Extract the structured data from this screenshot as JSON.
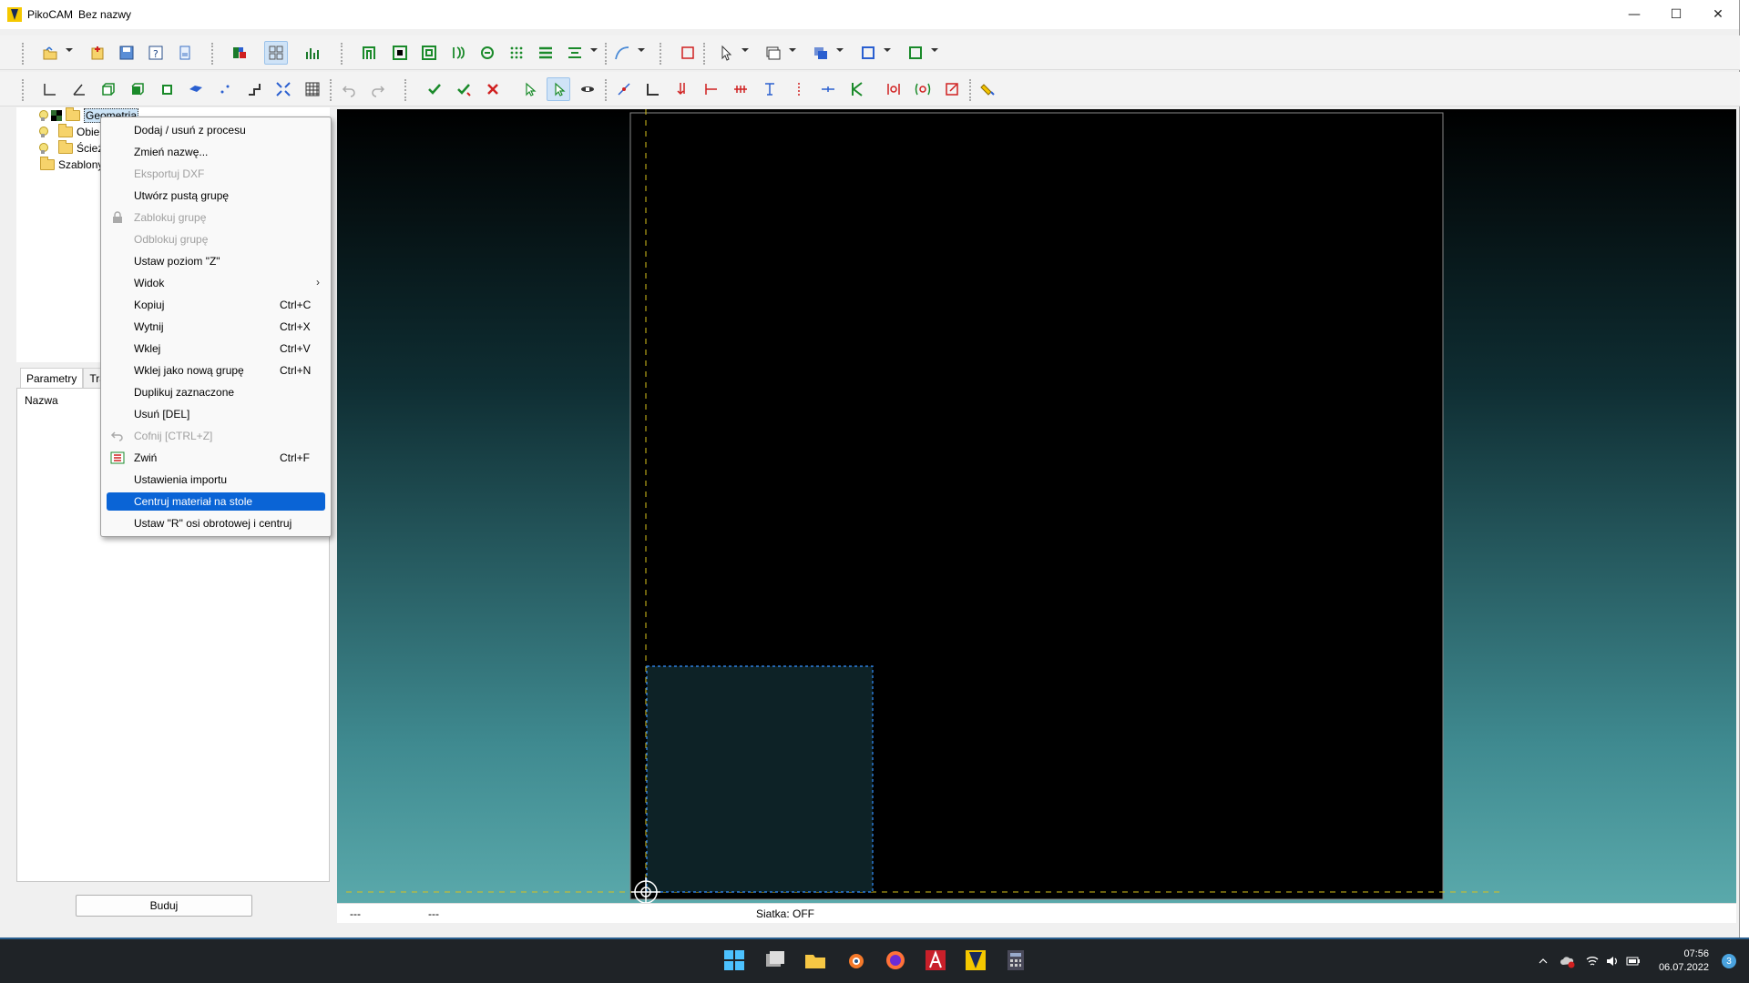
{
  "window": {
    "app_name": "PikoCAM",
    "doc_name": "Bez nazwy",
    "minimize": "—",
    "maximize": "☐",
    "close": "✕"
  },
  "tree": {
    "items": [
      {
        "label": "Geometria"
      },
      {
        "label": "Obiekt"
      },
      {
        "label": "Ścieżk"
      },
      {
        "label": "Szablony"
      }
    ]
  },
  "tabs": [
    {
      "label": "Parametry"
    },
    {
      "label": "Tra"
    }
  ],
  "params": {
    "header": "Nazwa"
  },
  "build_button": "Buduj",
  "context_menu": {
    "items": [
      {
        "label": "Dodaj / usuń z procesu",
        "shortcut": ""
      },
      {
        "label": "Zmień nazwę...",
        "shortcut": ""
      },
      {
        "label": "Eksportuj DXF",
        "shortcut": ""
      },
      {
        "label": "Utwórz pustą grupę",
        "shortcut": ""
      },
      {
        "label": "Zablokuj grupę",
        "shortcut": ""
      },
      {
        "label": "Odblokuj grupę",
        "shortcut": ""
      },
      {
        "label": "Ustaw poziom \"Z\"",
        "shortcut": ""
      },
      {
        "label": "Widok",
        "shortcut": ""
      },
      {
        "label": "Kopiuj",
        "shortcut": "Ctrl+C"
      },
      {
        "label": "Wytnij",
        "shortcut": "Ctrl+X"
      },
      {
        "label": "Wklej",
        "shortcut": "Ctrl+V"
      },
      {
        "label": "Wklej jako nową grupę",
        "shortcut": "Ctrl+N"
      },
      {
        "label": "Duplikuj zaznaczone",
        "shortcut": ""
      },
      {
        "label": "Usuń [DEL]",
        "shortcut": ""
      },
      {
        "label": "Cofnij [CTRL+Z]",
        "shortcut": ""
      },
      {
        "label": "Zwiń",
        "shortcut": "Ctrl+F"
      },
      {
        "label": "Ustawienia importu",
        "shortcut": ""
      },
      {
        "label": "Centruj materiał na stole",
        "shortcut": ""
      },
      {
        "label": "Ustaw \"R\" osi obrotowej i centruj",
        "shortcut": ""
      }
    ]
  },
  "status": {
    "left1": "---",
    "left2": "---",
    "grid": "Siatka: OFF"
  },
  "taskbar": {
    "time": "07:56",
    "date": "06.07.2022",
    "notifications": "3"
  }
}
